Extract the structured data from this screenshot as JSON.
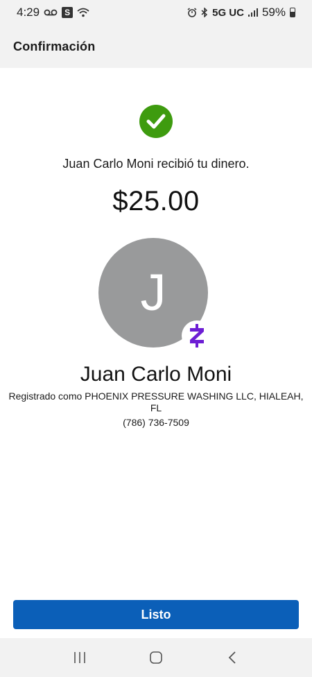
{
  "status_bar": {
    "time": "4:29",
    "s_badge": "S",
    "network": "5G UC",
    "battery": "59%",
    "icons": [
      "voicemail-icon",
      "wifi-icon",
      "alarm-icon",
      "bluetooth-icon",
      "signal-icon",
      "battery-icon"
    ]
  },
  "header": {
    "title": "Confirmación"
  },
  "confirmation": {
    "message": "Juan Carlo Moni recibió tu dinero.",
    "amount": "$25.00",
    "success_color": "#3e9b0f"
  },
  "recipient": {
    "avatar_initial": "J",
    "name": "Juan Carlo Moni",
    "registered_as": "Registrado como PHOENIX PRESSURE WASHING LLC, HIALEAH, FL",
    "phone": "(786) 736-7509",
    "badge_color": "#6d1ed4",
    "avatar_color": "#999a9b"
  },
  "actions": {
    "done_label": "Listo",
    "button_color": "#0b5fb8"
  },
  "nav_bar": {
    "icons": [
      "recent-apps-icon",
      "home-icon",
      "back-icon"
    ]
  }
}
